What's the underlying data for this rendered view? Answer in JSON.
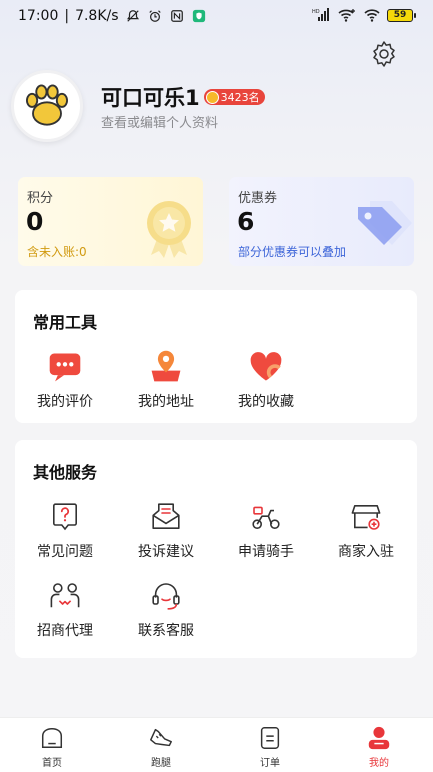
{
  "status_bar": {
    "time": "17:00",
    "network_speed": "7.8K/s",
    "battery": "59"
  },
  "profile": {
    "username": "可口可乐1",
    "rank": "3423名",
    "subtitle": "查看或编辑个人资料"
  },
  "points": {
    "label": "积分",
    "value": "0",
    "note": "含未入账:0"
  },
  "coupons": {
    "label": "优惠券",
    "value": "6",
    "note": "部分优惠券可以叠加"
  },
  "tools": {
    "title": "常用工具",
    "items": [
      {
        "label": "我的评价",
        "icon": "review-icon"
      },
      {
        "label": "我的地址",
        "icon": "address-icon"
      },
      {
        "label": "我的收藏",
        "icon": "favorite-icon"
      }
    ]
  },
  "services": {
    "title": "其他服务",
    "items": [
      {
        "label": "常见问题",
        "icon": "faq-icon"
      },
      {
        "label": "投诉建议",
        "icon": "complaint-icon"
      },
      {
        "label": "申请骑手",
        "icon": "rider-icon"
      },
      {
        "label": "商家入驻",
        "icon": "merchant-icon"
      },
      {
        "label": "招商代理",
        "icon": "agent-icon"
      },
      {
        "label": "联系客服",
        "icon": "support-icon"
      }
    ]
  },
  "tabbar": {
    "items": [
      {
        "label": "首页",
        "icon": "home-icon"
      },
      {
        "label": "跑腿",
        "icon": "errand-icon"
      },
      {
        "label": "订单",
        "icon": "orders-icon"
      },
      {
        "label": "我的",
        "icon": "profile-icon"
      }
    ]
  },
  "colors": {
    "accent_red": "#e8363a",
    "points_yellow": "#d19a10",
    "coupon_blue": "#3d65d8"
  }
}
